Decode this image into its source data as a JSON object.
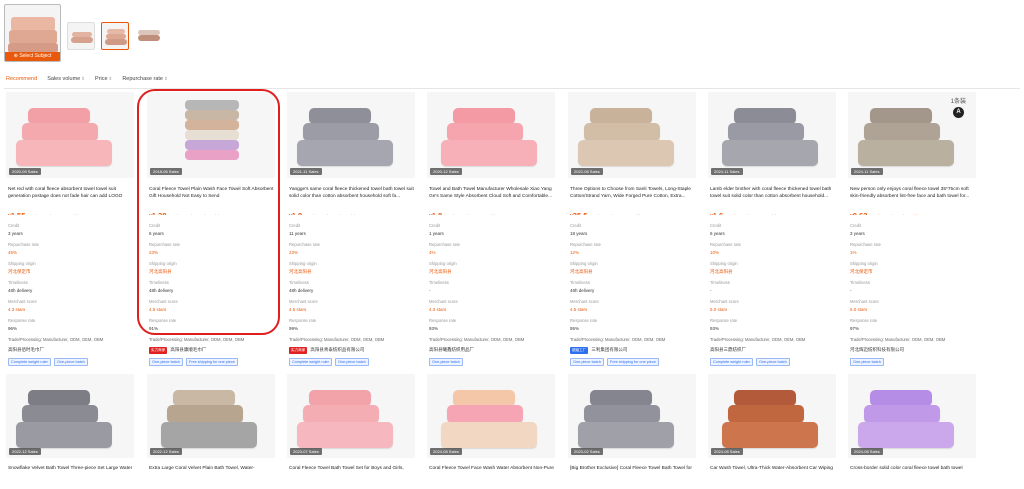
{
  "thumbnails": {
    "main_caption": "Select Subject",
    "items": [
      "main-towel-set",
      "towel-stack-a",
      "towel-stack-b",
      "towel-stack-c"
    ]
  },
  "sort_bar": {
    "items": [
      {
        "label": "Recommend",
        "active": true,
        "sortable": false
      },
      {
        "label": "Sales volume",
        "active": false,
        "sortable": true
      },
      {
        "label": "Price",
        "active": false,
        "sortable": true
      },
      {
        "label": "Repurchase rate",
        "active": false,
        "sortable": true
      }
    ]
  },
  "colors": {
    "accent": "#e8590c",
    "highlight": "#e01e1e",
    "chip_blue": "#2e6ff0"
  },
  "labels": {
    "credit": "Credit",
    "repurchase": "Repurchase rate",
    "shipping": "Shipping origin",
    "timeliness": "Timeliness",
    "merchant": "Merchant score",
    "response": "Response rate",
    "trade": "Trade/Processing: Manufacturer, ODM, OEM, OBM"
  },
  "products": [
    {
      "badge": "2020-09 Sales",
      "title": "Net red with coral fleece absorbent towel towel suit generation postage does not fade hair can add LOGO",
      "price_int": "1.55",
      "sales": "90 days sales: 700+ sold",
      "credit": "3 years",
      "repurchase": "45%",
      "shipping": "河北保定市",
      "timeliness": "48h delivery",
      "merchant": "4.3 stars",
      "response": "96%",
      "supplier": "高阳县佰时毛巾厂",
      "supplier_tag": "",
      "chips": [
        "Complete weight ruler",
        "One-piece batch"
      ],
      "palette": [
        "#f2a0a6",
        "#f4a9ae",
        "#f7b6ba"
      ]
    },
    {
      "badge": "2018-06 Sales",
      "title": "Coral Fleece Towel Plain Wash Face Towel Soft Absorbent Gift Household Not Easy to Send",
      "price_int": "1.38",
      "sales": "90 days sales: 40k+ sold",
      "credit": "6 years",
      "repurchase": "23%",
      "shipping": "河北高阳县",
      "timeliness": "48h delivery",
      "merchant": "4.5 stars",
      "response": "91%",
      "supplier": "高阳县康顺毛巾厂",
      "supplier_tag": "实力商家",
      "chips": [
        "One-piece batch",
        "Free shipping for one piece"
      ],
      "palette": [
        "#b7b7b7",
        "#c8b7a4",
        "#d3b39c",
        "#e7dfd3",
        "#c7a7d8",
        "#e9a2c6"
      ]
    },
    {
      "badge": "2021-11 Sales",
      "title": "Yangge's same coral fleece thickened towel bath towel suit solid color than cotton absorbent household soft fa...",
      "price_int": "1.8",
      "sales": "90 days sales: 29k+ sold",
      "credit": "11 years",
      "repurchase": "23%",
      "shipping": "河北高阳县",
      "timeliness": "48h delivery",
      "merchant": "4.5 stars",
      "response": "99%",
      "supplier": "高阳县青泰纺织品有限公司",
      "supplier_tag": "实力商家",
      "chips": [
        "Complete weight ruler",
        "One-piece batch"
      ],
      "palette": [
        "#8f8f9a",
        "#9c9ca6",
        "#a6a6b0"
      ]
    },
    {
      "badge": "2020-12 Sales",
      "title": "Towel and Bath Towel Manufacturer Wholesale Xiao Yang Ge's Same Style Absorbent Cloud Soft and Comfortable...",
      "price_int": "1.8",
      "sales": "90 days sales: 400+ sold",
      "credit": "1 years",
      "repurchase": "4%",
      "shipping": "河北高阳县",
      "timeliness": "-",
      "merchant": "4.3 stars",
      "response": "93%",
      "supplier": "高阳县曦鑫纺织用品厂",
      "supplier_tag": "",
      "chips": [
        "One-piece batch"
      ],
      "palette": [
        "#f49aa4",
        "#f6a5ae",
        "#f8b0b8"
      ]
    },
    {
      "badge": "2022-08 Sales",
      "title": "Three Options to Choose from Sanli Towels, Long-Staple Cotton/Strand Yarn, Wide Forged Pure Cotton, Extra...",
      "price_int": "35.5",
      "sales": "90 days sales: 300+ sold",
      "credit": "18 years",
      "repurchase": "12%",
      "shipping": "河北高阳县",
      "timeliness": "48h delivery",
      "merchant": "4.5 stars",
      "response": "95%",
      "supplier": "三利集团有限公司",
      "supplier_tag": "超级工厂",
      "chips": [
        "One-piece batch",
        "Free shipping for one piece"
      ],
      "palette": [
        "#c9b29a",
        "#d2bda6",
        "#dcc8b2"
      ]
    },
    {
      "badge": "2024-11 Sales",
      "title": "Lamb elder brother with coral fleece thickened towel bath towel suit solid color than cotton absorbent household...",
      "price_int": "1.6",
      "sales": "90 days sales: 500+ sold",
      "credit": "6 years",
      "repurchase": "10%",
      "shipping": "河北高阳县",
      "timeliness": "-",
      "merchant": "5.0 stars",
      "response": "93%",
      "supplier": "高阳县三鼎纺织厂",
      "supplier_tag": "",
      "chips": [
        "Complete weight ruler",
        "One-piece batch"
      ],
      "palette": [
        "#8c8c96",
        "#999aa3",
        "#a5a6ae"
      ]
    },
    {
      "badge": "2024-11 Sales",
      "title": "New person only enjoys coral fleece towel 35*75cm soft skin-friendly absorbent lint-free face and bath towel for...",
      "price_int": "0.63",
      "sales": "90 days sales: 6k+ sold",
      "credit": "3 years",
      "repurchase": "1%",
      "shipping": "河北保定市",
      "timeliness": "-",
      "merchant": "5.0 stars",
      "response": "97%",
      "supplier": "河北辉迈纺织科技有限公司",
      "supplier_tag": "",
      "chips": [
        "One-piece batch"
      ],
      "palette": [
        "#a2978a",
        "#aea394",
        "#bab09f"
      ],
      "watermark": "1条装",
      "circle": "A"
    }
  ],
  "row2": [
    {
      "badge": "2022-12 Sales",
      "title": "Snowflake Velvet Bath Towel Three-piece Set Large Water",
      "palette": [
        "#7d7d86",
        "#8b8b94",
        "#9a9aa2"
      ]
    },
    {
      "badge": "2022-12 Sales",
      "title": "Extra Large Coral Velvet Plain Bath Towel, Water-",
      "palette": [
        "#c9b8a4",
        "#b7a590",
        "#a5a5a5"
      ]
    },
    {
      "badge": "2023-07 Sales",
      "title": "Coral Fleece Towel Bath Towel Set for Boys and Girls,",
      "palette": [
        "#f2a2a9",
        "#f4adb3",
        "#f6b8be"
      ]
    },
    {
      "badge": "2024-08 Sales",
      "title": "Coral Fleece Towel Face Wash Water Absorbent Non-Pure",
      "palette": [
        "#f4c7a8",
        "#f5a5b4",
        "#f2d8c2"
      ]
    },
    {
      "badge": "2023-02 Sales",
      "title": "[Big Brother Exclusive] Coral Fleece Towel Bath Towel for",
      "palette": [
        "#858590",
        "#92929c",
        "#a0a0a8"
      ]
    },
    {
      "badge": "2024-08 Sales",
      "title": "Car Wash Towel, Ultra-Thick Water-Absorbent Car Wiping",
      "palette": [
        "#b35a3a",
        "#c0673f",
        "#cd764e"
      ]
    },
    {
      "badge": "2024-08 Sales",
      "title": "Cross-border solid color coral fleece towel bath towel",
      "palette": [
        "#b58ce6",
        "#c09ae9",
        "#cba8ec"
      ]
    }
  ]
}
